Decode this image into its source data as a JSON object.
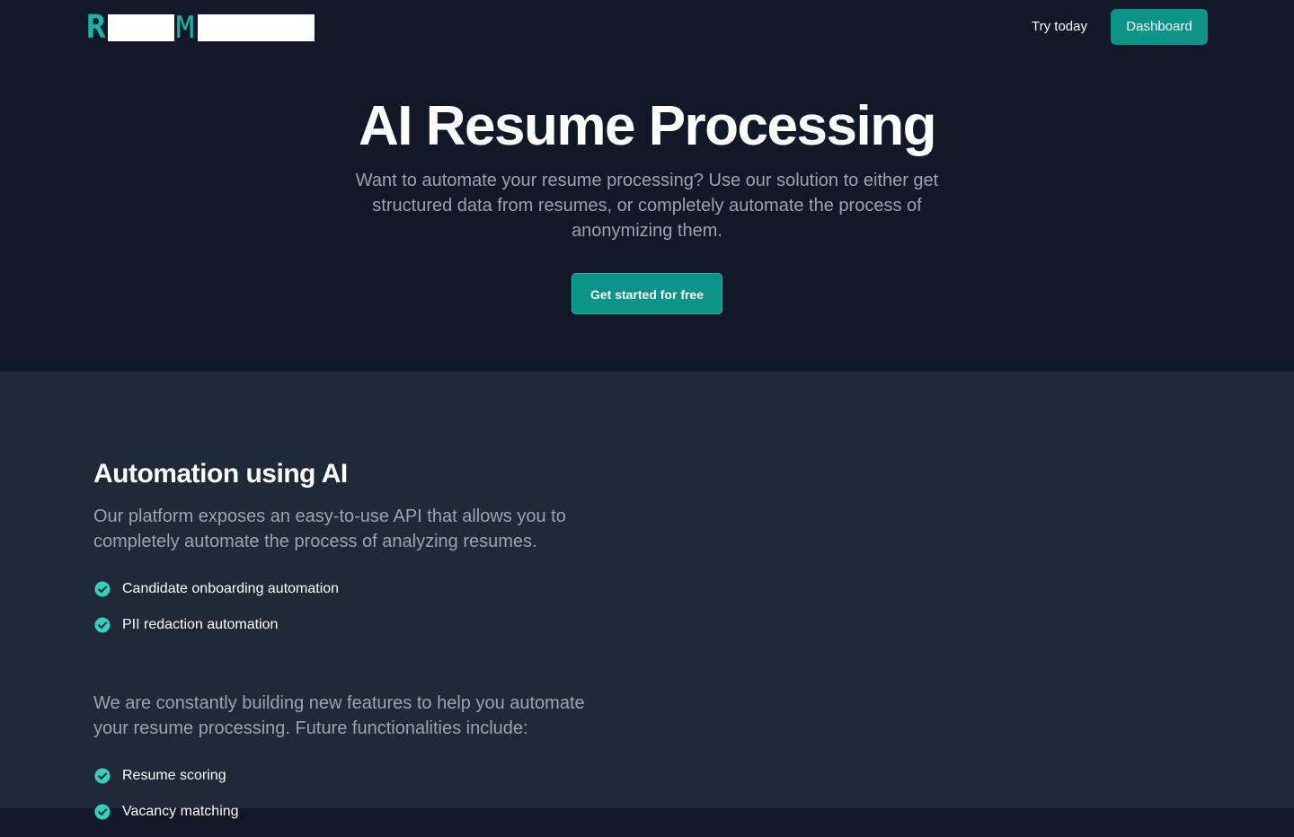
{
  "nav": {
    "logo_letter_1": "R",
    "logo_letter_2": "M",
    "try_label": "Try today",
    "dashboard_label": "Dashboard"
  },
  "hero": {
    "title": "AI Resume Processing",
    "subtitle": "Want to automate your resume processing? Use our solution to either get structured data from resumes, or completely automate the process of anonymizing them.",
    "cta_label": "Get started for free"
  },
  "features": {
    "title": "Automation using AI",
    "intro": "Our platform exposes an easy-to-use API that allows you to completely automate the process of analyzing resumes.",
    "current_items": [
      "Candidate onboarding automation",
      "PII redaction automation"
    ],
    "future_intro": "We are constantly building new features to help you automate your resume processing. Future functionalities include:",
    "future_items": [
      "Resume scoring",
      "Vacancy matching"
    ]
  },
  "colors": {
    "accent": "#0d9488",
    "check": "#2dd4bf",
    "hero_bg": "#111827",
    "section_bg": "#1f2937"
  },
  "icons": {
    "check": "check-circle-icon"
  }
}
